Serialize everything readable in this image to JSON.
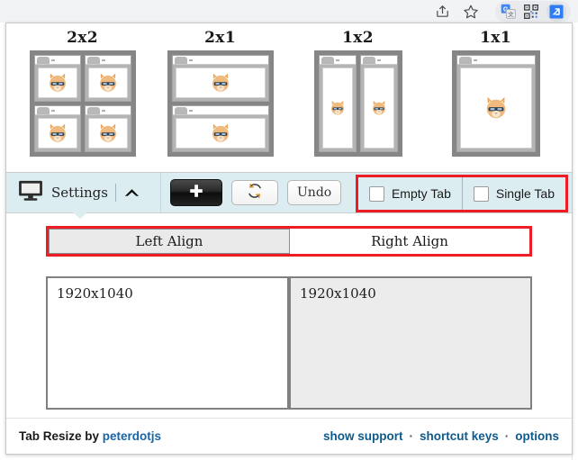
{
  "browser_chrome": {
    "icons": [
      {
        "name": "share-icon",
        "glyph": "share"
      },
      {
        "name": "bookmark-star-icon",
        "glyph": "star"
      },
      {
        "name": "google-translate-icon",
        "glyph": "translate"
      },
      {
        "name": "qr-code-icon",
        "glyph": "qr"
      },
      {
        "name": "tab-resize-extension-icon",
        "glyph": "resize-arrow"
      }
    ]
  },
  "layouts": [
    {
      "label": "2x2",
      "name": "layout-2x2",
      "grid": "g2x2",
      "panes": 4
    },
    {
      "label": "2x1",
      "name": "layout-2x1",
      "grid": "g2x1",
      "panes": 2
    },
    {
      "label": "1x2",
      "name": "layout-1x2",
      "grid": "g1x2",
      "panes": 2
    },
    {
      "label": "1x1",
      "name": "layout-1x1",
      "grid": "g1x1",
      "panes": 1
    }
  ],
  "toolbar": {
    "settings_label": "Settings",
    "monitor_icon": "monitor-icon",
    "collapse_icon": "chevron-up-icon",
    "add_label": "+",
    "add_icon": "plus-icon",
    "refresh_icon": "refresh-icon",
    "undo_label": "Undo",
    "checkboxes": [
      {
        "label": "Empty Tab",
        "name": "empty-tab-checkbox",
        "checked": false
      },
      {
        "label": "Single Tab",
        "name": "single-tab-checkbox",
        "checked": false
      }
    ]
  },
  "align": {
    "left_label": "Left Align",
    "right_label": "Right Align",
    "selected": "Left Align"
  },
  "resolution": {
    "left_value": "1920x1040",
    "right_value": "1920x1040"
  },
  "footer": {
    "credit_prefix": "Tab Resize by ",
    "credit_author": "peterdotjs",
    "links": [
      {
        "label": "show support",
        "name": "show-support-link"
      },
      {
        "label": "shortcut keys",
        "name": "shortcut-keys-link"
      },
      {
        "label": "options",
        "name": "options-link"
      }
    ],
    "separator": "·"
  },
  "colors": {
    "accent_red": "#ee1c25",
    "settings_blue": "#dcedf2",
    "link_blue": "#0d5b8c",
    "thumb_gray": "#868686"
  }
}
